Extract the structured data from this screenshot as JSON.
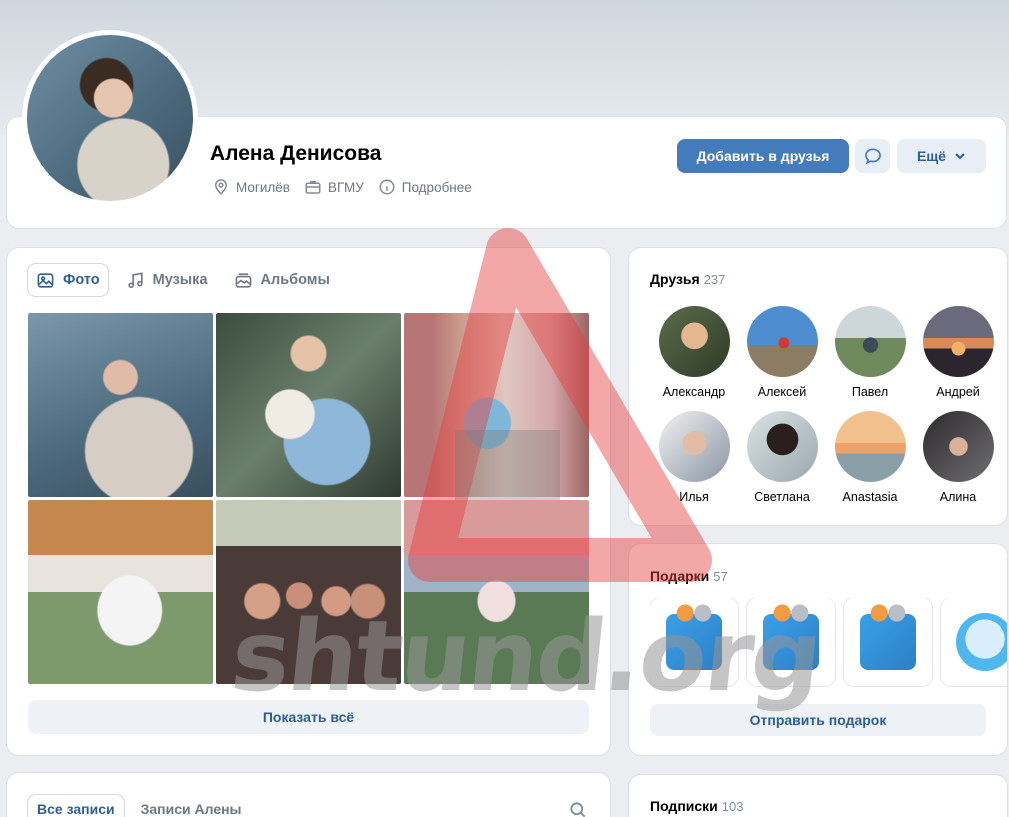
{
  "profile": {
    "name": "Алена Денисова",
    "city": "Могилёв",
    "university": "ВГМУ",
    "details_label": "Подробнее"
  },
  "actions": {
    "add_friend": "Добавить в друзья",
    "more": "Ещё"
  },
  "media_tabs": [
    {
      "label": "Фото",
      "icon": "photo-icon",
      "active": true
    },
    {
      "label": "Музыка",
      "icon": "music-icon",
      "active": false
    },
    {
      "label": "Альбомы",
      "icon": "albums-icon",
      "active": false
    }
  ],
  "photos": {
    "show_all": "Показать всё"
  },
  "friends": {
    "title": "Друзья",
    "count": "237",
    "items": [
      {
        "name": "Александр"
      },
      {
        "name": "Алексей"
      },
      {
        "name": "Павел"
      },
      {
        "name": "Андрей"
      },
      {
        "name": "Илья"
      },
      {
        "name": "Светлана"
      },
      {
        "name": "Anastasia"
      },
      {
        "name": "Алина"
      }
    ]
  },
  "gifts": {
    "title": "Подарки",
    "count": "57",
    "send_label": "Отправить подарок"
  },
  "wall": {
    "tab_all": "Все записи",
    "tab_own": "Записи Алены"
  },
  "subscriptions": {
    "title": "Подписки",
    "count": "103"
  },
  "watermark": {
    "text": "shtund.org"
  },
  "colors": {
    "accent": "#447bba",
    "link": "#2d5f95",
    "background": "#ebedf0",
    "secondary_text": "#6d7885"
  }
}
